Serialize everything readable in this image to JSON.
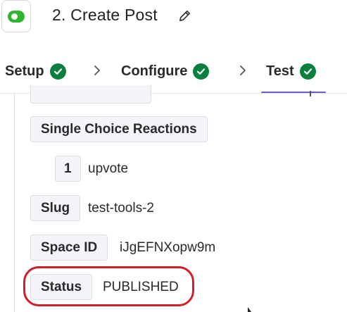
{
  "header": {
    "title": "2. Create Post",
    "app_icon": "toggle-app-icon",
    "edit_icon": "pencil-icon"
  },
  "tabs": [
    {
      "label": "Setup",
      "status": "complete"
    },
    {
      "label": "Configure",
      "status": "complete"
    },
    {
      "label": "Test",
      "status": "complete",
      "active": true
    }
  ],
  "fields": {
    "single_choice_reactions": {
      "label": "Single Choice Reactions"
    },
    "reaction_item": {
      "index": "1",
      "value": "upvote"
    },
    "slug": {
      "label": "Slug",
      "value": "test-tools-2"
    },
    "space_id": {
      "label": "Space ID",
      "value": "iJgEFNXopw9m"
    },
    "status": {
      "label": "Status",
      "value": "PUBLISHED"
    }
  },
  "colors": {
    "check_green": "#0b7f3e",
    "active_tab_underline": "#6d5bd0",
    "highlight_red": "#cf1f2a",
    "app_icon_green": "#2fb52f"
  }
}
